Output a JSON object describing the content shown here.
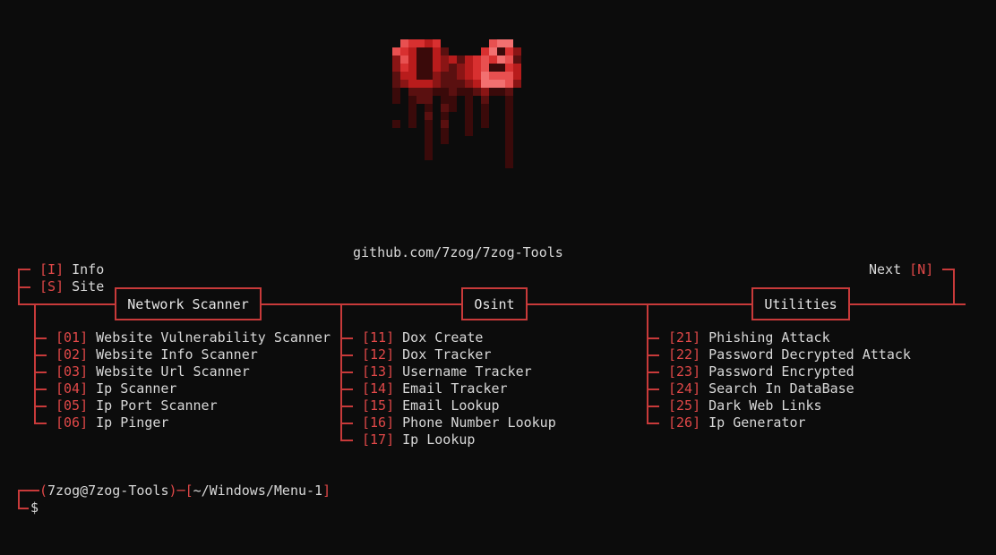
{
  "github": "github.com/7zog/7zog-Tools",
  "top_left": [
    {
      "key": "I",
      "label": "Info"
    },
    {
      "key": "S",
      "label": "Site"
    }
  ],
  "top_right": {
    "label": "Next",
    "key": "N"
  },
  "categories": [
    {
      "title": "Network Scanner",
      "items": [
        {
          "num": "01",
          "label": "Website Vulnerability Scanner"
        },
        {
          "num": "02",
          "label": "Website Info Scanner"
        },
        {
          "num": "03",
          "label": "Website Url Scanner"
        },
        {
          "num": "04",
          "label": "Ip Scanner"
        },
        {
          "num": "05",
          "label": "Ip Port Scanner"
        },
        {
          "num": "06",
          "label": "Ip Pinger"
        }
      ]
    },
    {
      "title": "Osint",
      "items": [
        {
          "num": "11",
          "label": "Dox Create"
        },
        {
          "num": "12",
          "label": "Dox Tracker"
        },
        {
          "num": "13",
          "label": "Username Tracker"
        },
        {
          "num": "14",
          "label": "Email Tracker"
        },
        {
          "num": "15",
          "label": "Email Lookup"
        },
        {
          "num": "16",
          "label": "Phone Number Lookup"
        },
        {
          "num": "17",
          "label": "Ip Lookup"
        }
      ]
    },
    {
      "title": "Utilities",
      "items": [
        {
          "num": "21",
          "label": "Phishing Attack"
        },
        {
          "num": "22",
          "label": "Password Decrypted Attack"
        },
        {
          "num": "23",
          "label": "Password Encrypted"
        },
        {
          "num": "24",
          "label": "Search In DataBase"
        },
        {
          "num": "25",
          "label": "Dark Web Links"
        },
        {
          "num": "26",
          "label": "Ip Generator"
        }
      ]
    }
  ],
  "prompt": {
    "user": "7zog@7zog-Tools",
    "path": "~/Windows/Menu-1",
    "symbol": "$"
  },
  "colors": {
    "background": "#0c0c0c",
    "accent": "#c83a3a",
    "bracket": "#e04848",
    "text": "#d8d8d8"
  },
  "logo": "7zog pixel logo"
}
